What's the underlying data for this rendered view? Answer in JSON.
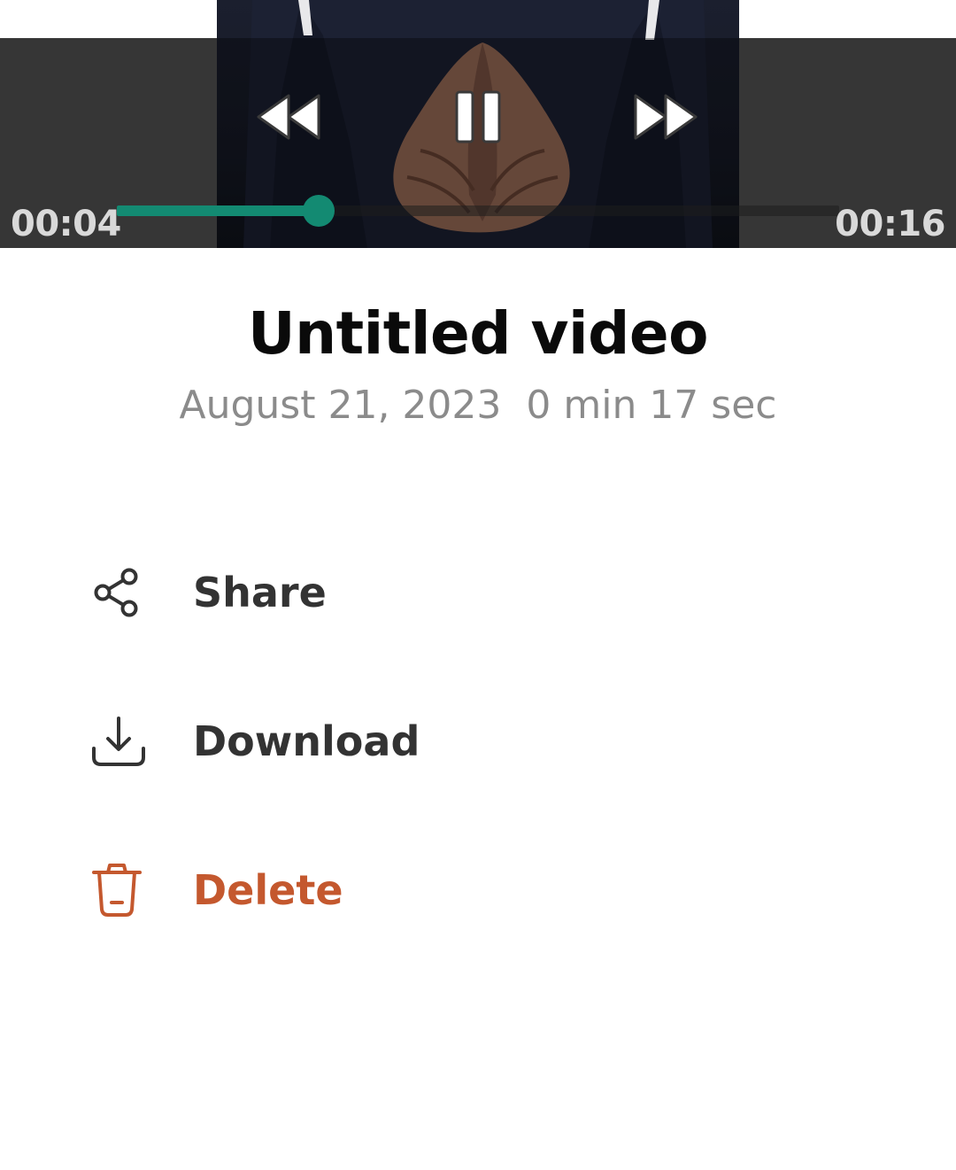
{
  "player": {
    "current_time": "00:04",
    "total_time": "00:16",
    "progress_fraction": 0.28,
    "accent_color": "#138a72",
    "controls": {
      "rewind_icon": "rewind-icon",
      "pause_icon": "pause-icon",
      "forward_icon": "fast-forward-icon"
    }
  },
  "video": {
    "title": "Untitled video",
    "meta": "August 21, 2023  0 min 17 sec"
  },
  "actions": [
    {
      "label": "Share",
      "icon": "share-icon",
      "color": "#333333"
    },
    {
      "label": "Download",
      "icon": "download-icon",
      "color": "#333333"
    },
    {
      "label": "Delete",
      "icon": "trash-icon",
      "color": "#c4582e"
    }
  ]
}
